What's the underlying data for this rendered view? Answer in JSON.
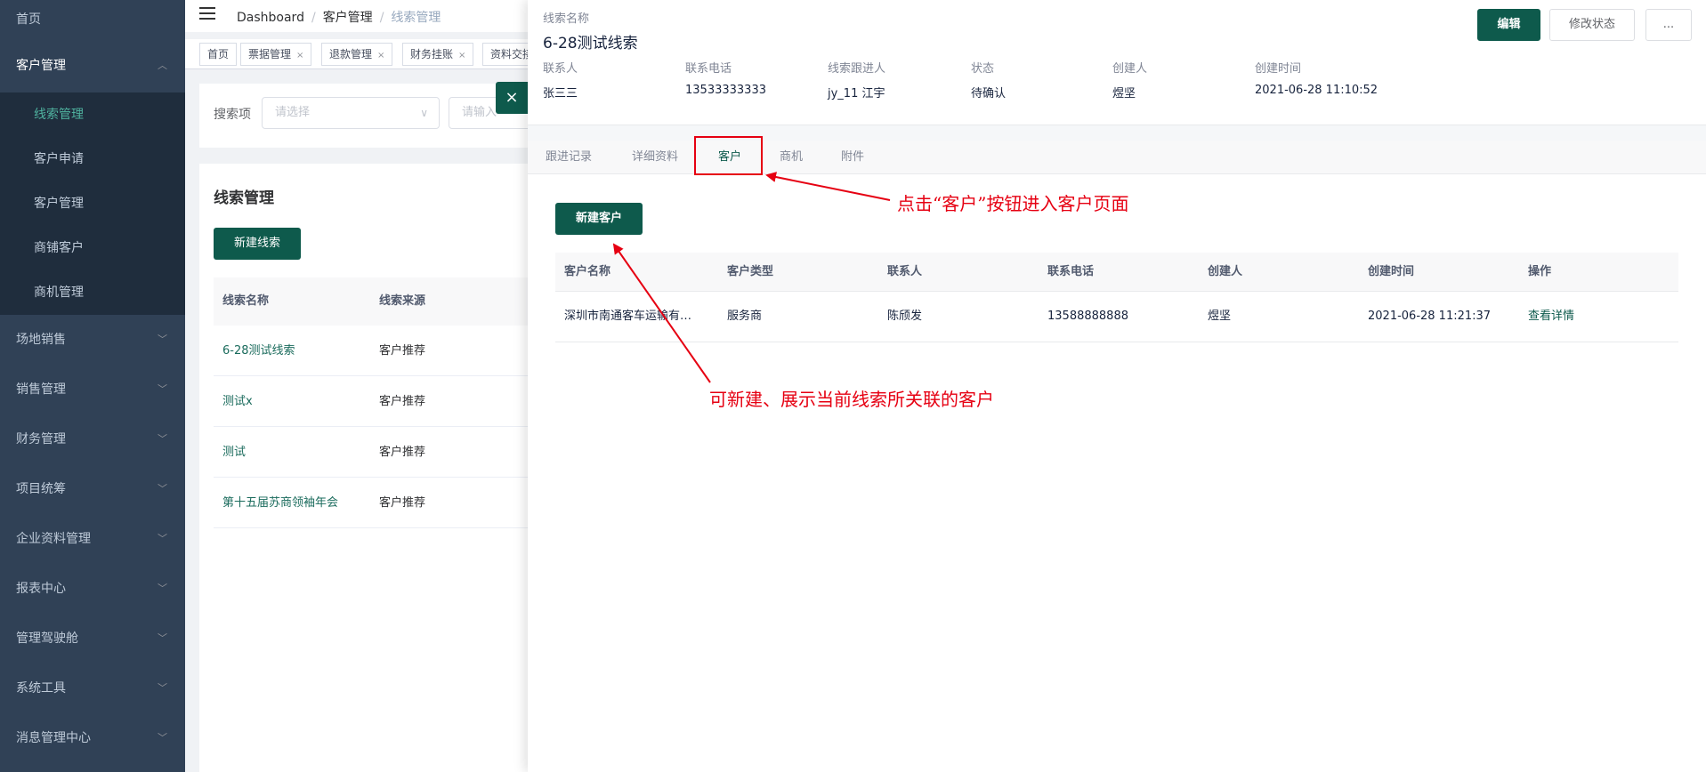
{
  "sidebar": {
    "items": [
      {
        "label": "首页"
      },
      {
        "label": "客户管理",
        "expanded": true,
        "children": [
          {
            "label": "线索管理",
            "active": true
          },
          {
            "label": "客户申请"
          },
          {
            "label": "客户管理"
          },
          {
            "label": "商铺客户"
          },
          {
            "label": "商机管理"
          }
        ]
      },
      {
        "label": "场地销售"
      },
      {
        "label": "销售管理"
      },
      {
        "label": "财务管理"
      },
      {
        "label": "项目统筹"
      },
      {
        "label": "企业资料管理"
      },
      {
        "label": "报表中心"
      },
      {
        "label": "管理驾驶舱"
      },
      {
        "label": "系统工具"
      },
      {
        "label": "消息管理中心"
      }
    ]
  },
  "breadcrumb": [
    "Dashboard",
    "客户管理",
    "线索管理"
  ],
  "tags": [
    "首页",
    "票据管理",
    "退款管理",
    "财务挂账",
    "资料交接"
  ],
  "search": {
    "label": "搜索项",
    "select_placeholder": "请选择",
    "input_placeholder": "请输入"
  },
  "list": {
    "title": "线索管理",
    "new_button": "新建线索",
    "columns": [
      "线索名称",
      "线索来源"
    ],
    "rows": [
      [
        "6-28测试线索",
        "客户推荐"
      ],
      [
        "测试x",
        "客户推荐"
      ],
      [
        "测试",
        "客户推荐"
      ],
      [
        "第十五届苏商领袖年会",
        "客户推荐"
      ]
    ]
  },
  "drawer": {
    "close_icon": "×",
    "name_label": "线索名称",
    "name": "6-28测试线索",
    "buttons": {
      "edit": "编辑",
      "status": "修改状态",
      "more": "..."
    },
    "info": [
      {
        "label": "联系人",
        "value": "张三三"
      },
      {
        "label": "联系电话",
        "value": "13533333333"
      },
      {
        "label": "线索跟进人",
        "value": "jy_11 江宇"
      },
      {
        "label": "状态",
        "value": "待确认"
      },
      {
        "label": "创建人",
        "value": "煜坚"
      },
      {
        "label": "创建时间",
        "value": "2021-06-28 11:10:52"
      }
    ],
    "tabs": [
      "跟进记录",
      "详细资料",
      "客户",
      "商机",
      "附件"
    ],
    "active_tab": "客户",
    "new_customer_button": "新建客户",
    "customer_table": {
      "columns": [
        "客户名称",
        "客户类型",
        "联系人",
        "联系电话",
        "创建人",
        "创建时间",
        "操作"
      ],
      "rows": [
        [
          "深圳市南通客车运输有…",
          "服务商",
          "陈颀发",
          "13588888888",
          "煜坚",
          "2021-06-28 11:21:37",
          "查看详情"
        ]
      ]
    }
  },
  "annotations": {
    "click_customer": "点击“客户”按钮进入客户页面",
    "new_show": "可新建、展示当前线索所关联的客户"
  },
  "colors": {
    "primary": "#0e5a4c",
    "annotation": "#e60012",
    "sidebar_bg": "#304156"
  }
}
